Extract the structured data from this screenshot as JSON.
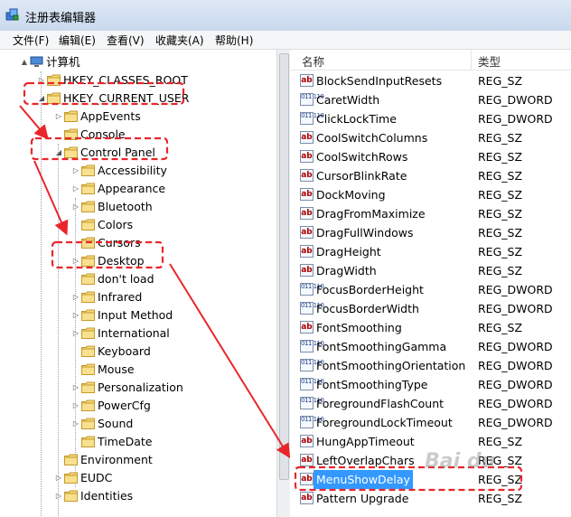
{
  "window": {
    "title": "注册表编辑器"
  },
  "menu": [
    "文件(F)",
    "编辑(E)",
    "查看(V)",
    "收藏夹(A)",
    "帮助(H)"
  ],
  "tree": {
    "root": "计算机",
    "items": [
      {
        "label": "HKEY_CLASSES_ROOT"
      },
      {
        "label": "HKEY_CURRENT_USER"
      },
      {
        "label": "AppEvents"
      },
      {
        "label": "Console"
      },
      {
        "label": "Control Panel"
      },
      {
        "label": "Accessibility"
      },
      {
        "label": "Appearance"
      },
      {
        "label": "Bluetooth"
      },
      {
        "label": "Colors"
      },
      {
        "label": "Cursors"
      },
      {
        "label": "Desktop"
      },
      {
        "label": "don't load"
      },
      {
        "label": "Infrared"
      },
      {
        "label": "Input Method"
      },
      {
        "label": "International"
      },
      {
        "label": "Keyboard"
      },
      {
        "label": "Mouse"
      },
      {
        "label": "Personalization"
      },
      {
        "label": "PowerCfg"
      },
      {
        "label": "Sound"
      },
      {
        "label": "TimeDate"
      },
      {
        "label": "Environment"
      },
      {
        "label": "EUDC"
      },
      {
        "label": "Identities"
      }
    ]
  },
  "list": {
    "columns": {
      "name": "名称",
      "type": "类型"
    },
    "rows": [
      {
        "name": "BlockSendInputResets",
        "type": "REG_SZ"
      },
      {
        "name": "CaretWidth",
        "type": "REG_DWORD"
      },
      {
        "name": "ClickLockTime",
        "type": "REG_DWORD"
      },
      {
        "name": "CoolSwitchColumns",
        "type": "REG_SZ"
      },
      {
        "name": "CoolSwitchRows",
        "type": "REG_SZ"
      },
      {
        "name": "CursorBlinkRate",
        "type": "REG_SZ"
      },
      {
        "name": "DockMoving",
        "type": "REG_SZ"
      },
      {
        "name": "DragFromMaximize",
        "type": "REG_SZ"
      },
      {
        "name": "DragFullWindows",
        "type": "REG_SZ"
      },
      {
        "name": "DragHeight",
        "type": "REG_SZ"
      },
      {
        "name": "DragWidth",
        "type": "REG_SZ"
      },
      {
        "name": "FocusBorderHeight",
        "type": "REG_DWORD"
      },
      {
        "name": "FocusBorderWidth",
        "type": "REG_DWORD"
      },
      {
        "name": "FontSmoothing",
        "type": "REG_SZ"
      },
      {
        "name": "FontSmoothingGamma",
        "type": "REG_DWORD"
      },
      {
        "name": "FontSmoothingOrientation",
        "type": "REG_DWORD"
      },
      {
        "name": "FontSmoothingType",
        "type": "REG_DWORD"
      },
      {
        "name": "ForegroundFlashCount",
        "type": "REG_DWORD"
      },
      {
        "name": "ForegroundLockTimeout",
        "type": "REG_DWORD"
      },
      {
        "name": "HungAppTimeout",
        "type": "REG_SZ"
      },
      {
        "name": "LeftOverlapChars",
        "type": "REG_SZ"
      },
      {
        "name": "MenuShowDelay",
        "type": "REG_SZ"
      },
      {
        "name": "Pattern Upgrade",
        "type": "REG_SZ"
      }
    ]
  },
  "watermark": "Bai du",
  "colors": {
    "annotation": "#e8262b",
    "selection": "#3399ff"
  }
}
